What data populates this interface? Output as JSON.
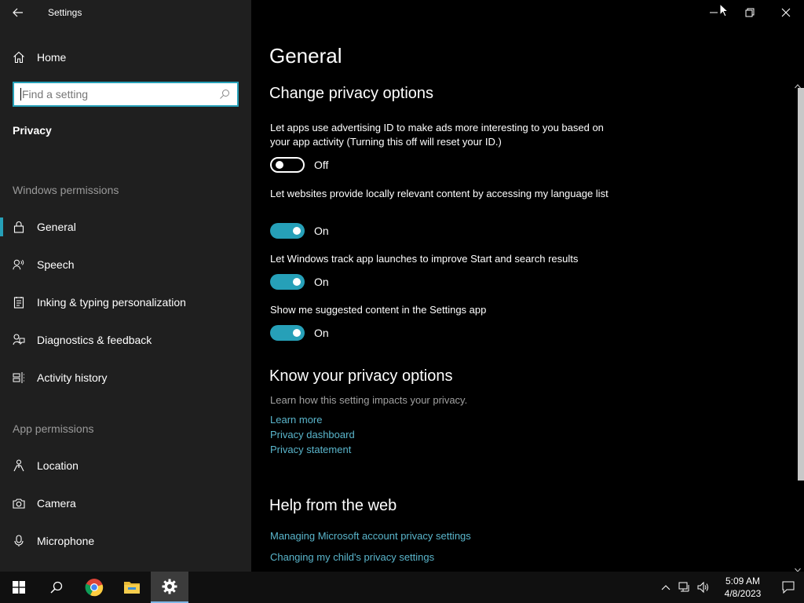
{
  "window": {
    "title": "Settings"
  },
  "sidebar": {
    "home_label": "Home",
    "search_placeholder": "Find a setting",
    "section_title": "Privacy",
    "windows_permissions_label": "Windows permissions",
    "windows_items": [
      {
        "label": "General",
        "icon": "lock-icon",
        "active": true
      },
      {
        "label": "Speech",
        "icon": "speech-icon"
      },
      {
        "label": "Inking & typing personalization",
        "icon": "inking-icon"
      },
      {
        "label": "Diagnostics & feedback",
        "icon": "feedback-icon"
      },
      {
        "label": "Activity history",
        "icon": "timeline-icon"
      }
    ],
    "app_permissions_label": "App permissions",
    "app_items": [
      {
        "label": "Location",
        "icon": "location-icon"
      },
      {
        "label": "Camera",
        "icon": "camera-icon"
      },
      {
        "label": "Microphone",
        "icon": "microphone-icon"
      }
    ]
  },
  "main": {
    "page_title": "General",
    "change_heading": "Change privacy options",
    "options": [
      {
        "text": "Let apps use advertising ID to make ads more interesting to you based on your app activity (Turning this off will reset your ID.)",
        "state": "Off"
      },
      {
        "text": "Let websites provide locally relevant content by accessing my language list",
        "state": "On"
      },
      {
        "text": "Let Windows track app launches to improve Start and search results",
        "state": "On"
      },
      {
        "text": "Show me suggested content in the Settings app",
        "state": "On"
      }
    ],
    "know_heading": "Know your privacy options",
    "know_desc": "Learn how this setting impacts your privacy.",
    "know_links": [
      "Learn more",
      "Privacy dashboard",
      "Privacy statement"
    ],
    "help_heading": "Help from the web",
    "help_links": [
      "Managing Microsoft account privacy settings",
      "Changing my child's privacy settings"
    ]
  },
  "taskbar": {
    "time": "5:09 AM",
    "date": "4/8/2023"
  },
  "colors": {
    "accent": "#26a0b8",
    "link": "#5ab6cc",
    "sidebar_bg": "#1f1f1f",
    "main_bg": "#000000"
  }
}
